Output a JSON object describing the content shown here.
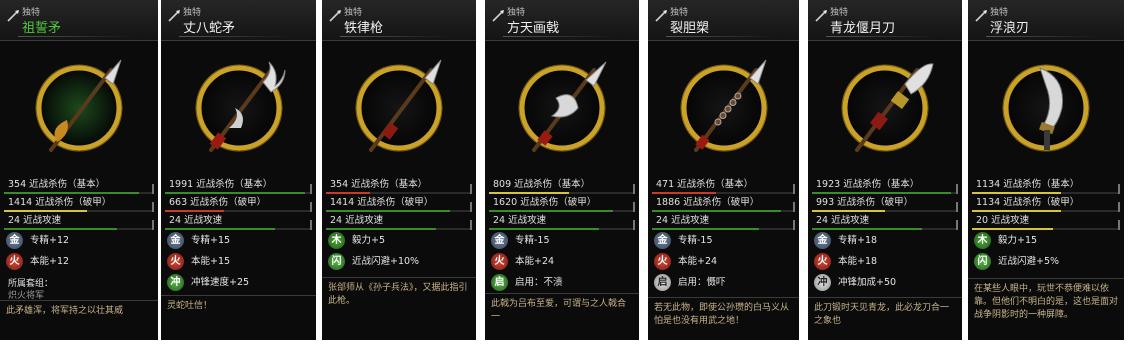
{
  "cards": [
    {
      "rarity": "独特",
      "name": "祖誓矛",
      "name_color": "#4ec83c",
      "weapon": "spear",
      "stats": [
        {
          "text": "354 近战杀伤（基本）",
          "fill": 0.9,
          "color": "#3a8c2a"
        },
        {
          "text": "1414 近战杀伤（破甲）",
          "fill": 0.55,
          "color": "#d8c43a"
        },
        {
          "text": "24 近战攻速",
          "fill": 0.75,
          "color": "#3a8c2a"
        }
      ],
      "traits": [
        {
          "el": "金",
          "cls": "el-metal",
          "text": "专精+12"
        },
        {
          "el": "火",
          "cls": "el-fire",
          "text": "本能+12"
        }
      ],
      "set_title": "所属套组：",
      "set_name": "炽火将军",
      "flavor": "此矛雄浑，将军持之以壮其威"
    },
    {
      "rarity": "独特",
      "name": "丈八蛇矛",
      "name_color": "#f0f0f0",
      "weapon": "snake",
      "stats": [
        {
          "text": "1991 近战杀伤（基本）",
          "fill": 0.95,
          "color": "#3a8c2a"
        },
        {
          "text": "663 近战杀伤（破甲）",
          "fill": 0.4,
          "color": "#c83a2a"
        },
        {
          "text": "24 近战攻速",
          "fill": 0.75,
          "color": "#3a8c2a"
        }
      ],
      "traits": [
        {
          "el": "金",
          "cls": "el-metal",
          "text": "专精+15"
        },
        {
          "el": "火",
          "cls": "el-fire",
          "text": "本能+15"
        },
        {
          "el": "冲",
          "cls": "el-green",
          "text": "冲锋速度+25"
        }
      ],
      "flavor": "灵蛇吐信！"
    },
    {
      "rarity": "独特",
      "name": "铁律枪",
      "name_color": "#f0f0f0",
      "weapon": "spear2",
      "stats": [
        {
          "text": "354 近战杀伤（基本）",
          "fill": 0.3,
          "color": "#c83a2a"
        },
        {
          "text": "1414 近战杀伤（破甲）",
          "fill": 0.85,
          "color": "#3a8c2a"
        },
        {
          "text": "24 近战攻速",
          "fill": 0.75,
          "color": "#3a8c2a"
        }
      ],
      "traits": [
        {
          "el": "木",
          "cls": "el-wood",
          "text": "毅力+5"
        },
        {
          "el": "闪",
          "cls": "el-green",
          "text": "近战闪避+10%"
        }
      ],
      "flavor": "张郃师从《孙子兵法》，又据此指引此枪。"
    },
    {
      "rarity": "独特",
      "name": "方天画戟",
      "name_color": "#f0f0f0",
      "weapon": "halberd",
      "stats": [
        {
          "text": "809 近战杀伤（基本）",
          "fill": 0.55,
          "color": "#d8c43a"
        },
        {
          "text": "1620 近战杀伤（破甲）",
          "fill": 0.85,
          "color": "#3a8c2a"
        },
        {
          "text": "24 近战攻速",
          "fill": 0.75,
          "color": "#3a8c2a"
        }
      ],
      "traits": [
        {
          "el": "金",
          "cls": "el-metal",
          "text": "专精-15"
        },
        {
          "el": "火",
          "cls": "el-fire",
          "text": "本能+24"
        },
        {
          "el": "启",
          "cls": "el-green",
          "text": "启用：不溃"
        }
      ],
      "flavor": "此戟为吕布至爱，可谓与之人戟合一"
    },
    {
      "rarity": "独特",
      "name": "裂胆槊",
      "name_color": "#f0f0f0",
      "weapon": "mace",
      "stats": [
        {
          "text": "471 近战杀伤（基本）",
          "fill": 0.45,
          "color": "#c83a2a"
        },
        {
          "text": "1886 近战杀伤（破甲）",
          "fill": 0.9,
          "color": "#3a8c2a"
        },
        {
          "text": "24 近战攻速",
          "fill": 0.75,
          "color": "#3a8c2a"
        }
      ],
      "traits": [
        {
          "el": "金",
          "cls": "el-metal",
          "text": "专精-15"
        },
        {
          "el": "火",
          "cls": "el-fire",
          "text": "本能+24"
        },
        {
          "el": "启",
          "cls": "el-white",
          "text": "启用：慑吓"
        }
      ],
      "flavor": "若无此物，即使公孙瓒的白马义从怕是也没有用武之地！"
    },
    {
      "rarity": "独特",
      "name": "青龙偃月刀",
      "name_color": "#f0f0f0",
      "weapon": "glaive",
      "stats": [
        {
          "text": "1923 近战杀伤（基本）",
          "fill": 0.95,
          "color": "#3a8c2a"
        },
        {
          "text": "993 近战杀伤（破甲）",
          "fill": 0.5,
          "color": "#d8c43a"
        },
        {
          "text": "24 近战攻速",
          "fill": 0.75,
          "color": "#3a8c2a"
        }
      ],
      "traits": [
        {
          "el": "金",
          "cls": "el-metal",
          "text": "专精+18"
        },
        {
          "el": "火",
          "cls": "el-fire",
          "text": "本能+18"
        },
        {
          "el": "冲",
          "cls": "el-white",
          "text": "冲锋加成+50"
        }
      ],
      "flavor": "此刀锻时天见青龙，此必龙刀合一之象也"
    },
    {
      "rarity": "独特",
      "name": "浮浪刃",
      "name_color": "#f0f0f0",
      "weapon": "blade",
      "stats": [
        {
          "text": "1134 近战杀伤（基本）",
          "fill": 0.6,
          "color": "#d8c43a"
        },
        {
          "text": "1134 近战杀伤（破甲）",
          "fill": 0.6,
          "color": "#d8c43a"
        },
        {
          "text": "20 近战攻速",
          "fill": 0.55,
          "color": "#d8c43a"
        }
      ],
      "traits": [
        {
          "el": "木",
          "cls": "el-wood",
          "text": "毅力+15"
        },
        {
          "el": "闪",
          "cls": "el-green",
          "text": "近战闪避+5%"
        }
      ],
      "flavor": "在某些人眼中，玩世不恭便难以依靠。但他们不明白的是，这也是面对战争阴影时的一种屏障。"
    }
  ]
}
